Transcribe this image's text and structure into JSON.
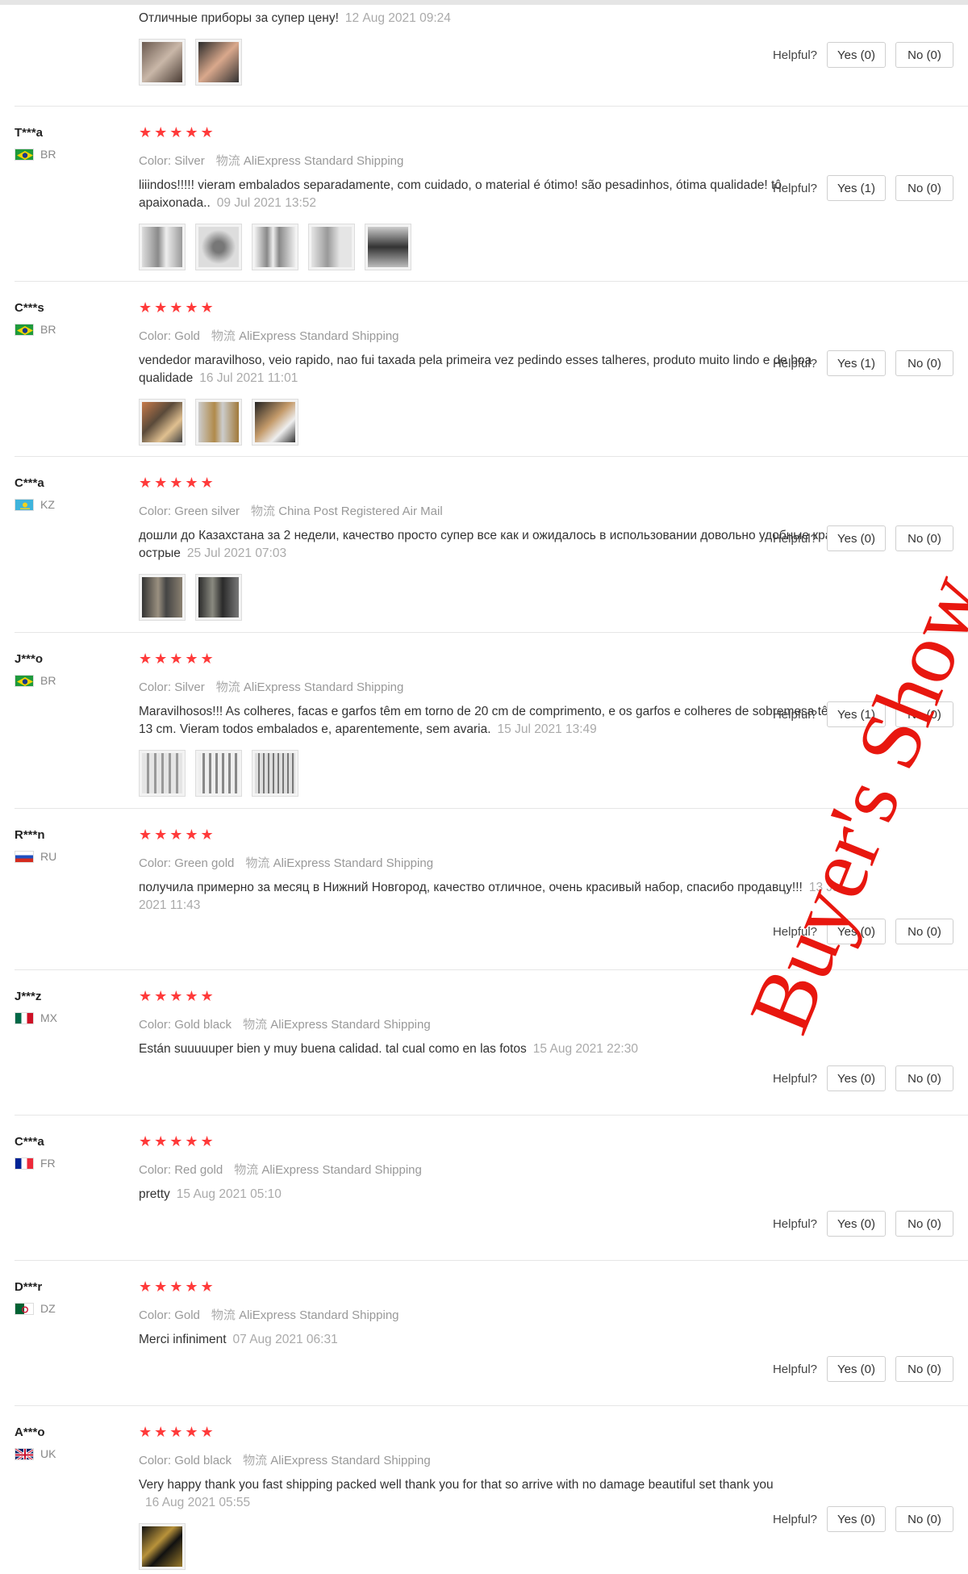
{
  "labels": {
    "color_label": "Color:",
    "ship_icon_text": "物流",
    "helpful": "Helpful?"
  },
  "watermark": "Buyer's Show",
  "reviews": [
    {
      "text": "Отличные приборы за супер цену!",
      "date": "12 Aug 2021 09:24",
      "yes": "Yes (0)",
      "no": "No (0)"
    },
    {
      "user": "T***a",
      "country": "BR",
      "color": "Silver",
      "shipping": "AliExpress Standard Shipping",
      "text": "liiindos!!!!! vieram embalados separadamente, com cuidado, o material é ótimo! são pesadinhos, ótima qualidade! tô apaixonada..",
      "date": "09 Jul 2021 13:52",
      "yes": "Yes (1)",
      "no": "No (0)"
    },
    {
      "user": "C***s",
      "country": "BR",
      "color": "Gold",
      "shipping": "AliExpress Standard Shipping",
      "text": "vendedor maravilhoso, veio rapido, nao fui taxada pela primeira vez pedindo esses talheres, produto muito lindo e de boa qualidade",
      "date": "16 Jul 2021 11:01",
      "yes": "Yes (1)",
      "no": "No (0)"
    },
    {
      "user": "C***a",
      "country": "KZ",
      "color": "Green silver",
      "shipping": "China Post Registered Air Mail",
      "text": "дошли до Казахстана за 2 недели, качество просто супер все как и ожидалось в использовании довольно удобные края не острые",
      "date": "25 Jul 2021 07:03",
      "yes": "Yes (0)",
      "no": "No (0)"
    },
    {
      "user": "J***o",
      "country": "BR",
      "color": "Silver",
      "shipping": "AliExpress Standard Shipping",
      "text": "Maravilhosos!!! As colheres, facas e garfos têm em torno de 20 cm de comprimento, e os garfos e colheres de sobremesa têm uns 13 cm. Vieram todos embalados e, aparentemente, sem avaria.",
      "date": "15 Jul 2021 13:49",
      "yes": "Yes (1)",
      "no": "No (0)"
    },
    {
      "user": "R***n",
      "country": "RU",
      "color": "Green gold",
      "shipping": "AliExpress Standard Shipping",
      "text": "получила примерно за месяц в Нижний Новгород, качество отличное, очень красивый набор, спасибо продавцу!!!",
      "date": "13 Jul 2021 11:43",
      "yes": "Yes (0)",
      "no": "No (0)"
    },
    {
      "user": "J***z",
      "country": "MX",
      "color": "Gold black",
      "shipping": "AliExpress Standard Shipping",
      "text": "Están suuuuuper bien y muy buena calidad. tal cual como en las fotos",
      "date": "15 Aug 2021 22:30",
      "yes": "Yes (0)",
      "no": "No (0)"
    },
    {
      "user": "C***a",
      "country": "FR",
      "color": "Red gold",
      "shipping": "AliExpress Standard Shipping",
      "text": "pretty",
      "date": "15 Aug 2021 05:10",
      "yes": "Yes (0)",
      "no": "No (0)"
    },
    {
      "user": "D***r",
      "country": "DZ",
      "color": "Gold",
      "shipping": "AliExpress Standard Shipping",
      "text": "Merci infiniment",
      "date": "07 Aug 2021 06:31",
      "yes": "Yes (0)",
      "no": "No (0)"
    },
    {
      "user": "A***o",
      "country": "UK",
      "color": "Gold black",
      "shipping": "AliExpress Standard Shipping",
      "text": "Very happy thank you fast shipping packed well thank you for that so arrive with no damage beautiful set thank you",
      "date": "16 Aug 2021 05:55",
      "yes": "Yes (0)",
      "no": "No (0)"
    }
  ]
}
